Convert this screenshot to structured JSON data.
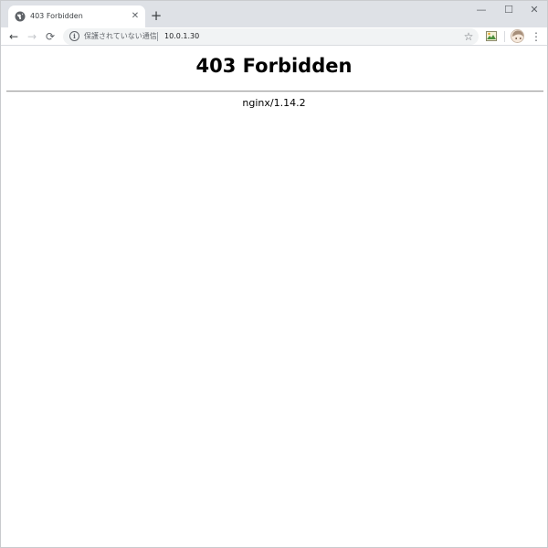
{
  "browser": {
    "tab": {
      "title": "403 Forbidden",
      "favicon": "globe-icon",
      "close_glyph": "✕"
    },
    "new_tab_glyph": "+",
    "window_controls": {
      "minimize": "—",
      "maximize": "☐",
      "close": "✕"
    },
    "toolbar": {
      "back_glyph": "←",
      "forward_glyph": "→",
      "reload_glyph": "⟳",
      "security_label": "保護されていない通信",
      "url": "10.0.1.30",
      "bookmark_glyph": "☆",
      "menu_glyph": "⋮"
    }
  },
  "page": {
    "heading": "403 Forbidden",
    "server_signature": "nginx/1.14.2"
  }
}
